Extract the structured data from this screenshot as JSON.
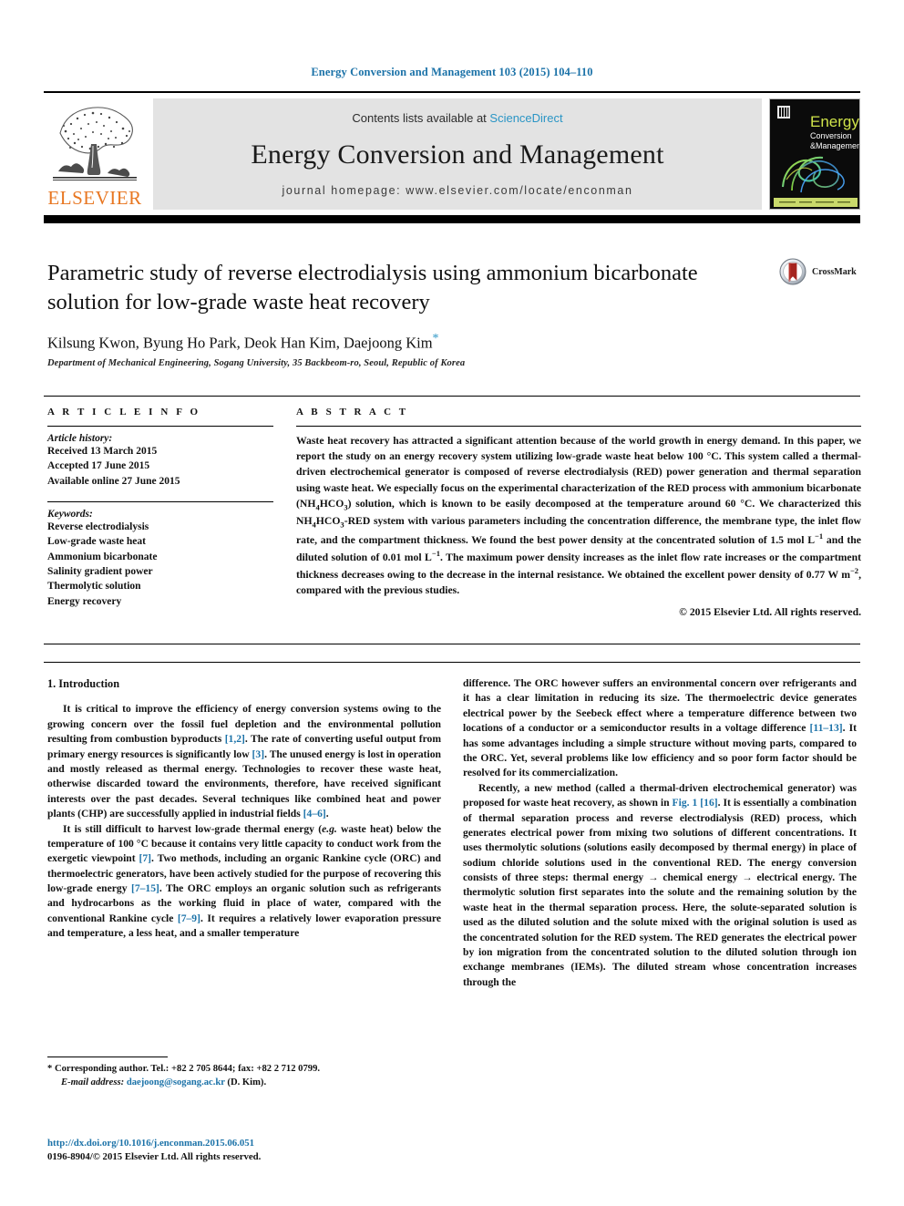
{
  "running_head": "Energy Conversion and Management 103 (2015) 104–110",
  "masthead": {
    "publisher": "ELSEVIER",
    "contents_prefix": "Contents lists available at ",
    "contents_link": "ScienceDirect",
    "journal_title": "Energy Conversion and Management",
    "homepage": "journal homepage: www.elsevier.com/locate/enconman",
    "cover": {
      "line1": "Energy",
      "line2": "Conversion",
      "line3": "&Management"
    }
  },
  "article": {
    "title": "Parametric study of reverse electrodialysis using ammonium bicarbonate solution for low-grade waste heat recovery",
    "authors": "Kilsung Kwon, Byung Ho Park, Deok Han Kim, Daejoong Kim",
    "corresponding_marker": "*",
    "affiliation": "Department of Mechanical Engineering, Sogang University, 35 Backbeom-ro, Seoul, Republic of Korea",
    "crossmark_label": "CrossMark"
  },
  "article_info": {
    "heading": "A R T I C L E   I N F O",
    "history_label": "Article history:",
    "history": [
      "Received 13 March 2015",
      "Accepted 17 June 2015",
      "Available online 27 June 2015"
    ],
    "keywords_label": "Keywords:",
    "keywords": [
      "Reverse electrodialysis",
      "Low-grade waste heat",
      "Ammonium bicarbonate",
      "Salinity gradient power",
      "Thermolytic solution",
      "Energy recovery"
    ]
  },
  "abstract": {
    "heading": "A B S T R A C T",
    "part1": "Waste heat recovery has attracted a significant attention because of the world growth in energy demand. In this paper, we report the study on an energy recovery system utilizing low-grade waste heat below 100 °C. This system called a thermal-driven electrochemical generator is composed of reverse electrodialysis (RED) power generation and thermal separation using waste heat. We especially focus on the experimental characterization of the RED process with ammonium bicarbonate (NH",
    "sub1": "4",
    "part2": "HCO",
    "sub2": "3",
    "part3": ") solution, which is known to be easily decomposed at the temperature around 60 °C. We characterized this NH",
    "sub3": "4",
    "part4": "HCO",
    "sub4": "3",
    "part5": "-RED system with various parameters including the concentration difference, the membrane type, the inlet flow rate, and the compartment thickness. We found the best power density at the concentrated solution of 1.5 mol L",
    "sup1": "−1",
    "part6": " and the diluted solution of 0.01 mol L",
    "sup2": "−1",
    "part7": ". The maximum power density increases as the inlet flow rate increases or the compartment thickness decreases owing to the decrease in the internal resistance. We obtained the excellent power density of 0.77 W m",
    "sup3": "−2",
    "part8": ", compared with the previous studies.",
    "copyright": "© 2015 Elsevier Ltd. All rights reserved."
  },
  "body": {
    "section_heading": "1. Introduction",
    "left": {
      "p1_a": "It is critical to improve the efficiency of energy conversion systems owing to the growing concern over the fossil fuel depletion and the environmental pollution resulting from combustion byproducts ",
      "p1_ref1": "[1,2]",
      "p1_b": ". The rate of converting useful output from primary energy resources is significantly low ",
      "p1_ref2": "[3]",
      "p1_c": ". The unused energy is lost in operation and mostly released as thermal energy. Technologies to recover these waste heat, otherwise discarded toward the environments, therefore, have received significant interests over the past decades. Several techniques like combined heat and power plants (CHP) are successfully applied in industrial fields ",
      "p1_ref3": "[4–6]",
      "p1_d": ".",
      "p2_a": "It is still difficult to harvest low-grade thermal energy (",
      "p2_it": "e.g.",
      "p2_b": " waste heat) below the temperature of 100 °C because it contains very little capacity to conduct work from the exergetic viewpoint ",
      "p2_ref1": "[7]",
      "p2_c": ". Two methods, including an organic Rankine cycle (ORC) and thermoelectric generators, have been actively studied for the purpose of recovering this low-grade energy ",
      "p2_ref2": "[7–15]",
      "p2_d": ". The ORC employs an organic solution such as refrigerants and hydrocarbons as the working fluid in place of water, compared with the conventional Rankine cycle ",
      "p2_ref3": "[7–9]",
      "p2_e": ". It requires a relatively lower evaporation pressure and temperature, a less heat, and a smaller temperature"
    },
    "right": {
      "p1_a": "difference. The ORC however suffers an environmental concern over refrigerants and it has a clear limitation in reducing its size. The thermoelectric device generates electrical power by the Seebeck effect where a temperature difference between two locations of a conductor or a semiconductor results in a voltage difference ",
      "p1_ref1": "[11–13]",
      "p1_b": ". It has some advantages including a simple structure without moving parts, compared to the ORC. Yet, several problems like low efficiency and so poor form factor should be resolved for its commercialization.",
      "p2_a": "Recently, a new method (called a thermal-driven electrochemical generator) was proposed for waste heat recovery, as shown in ",
      "p2_ref1": "Fig. 1",
      "p2_mid": " ",
      "p2_ref2": "[16]",
      "p2_b": ". It is essentially a combination of thermal separation process and reverse electrodialysis (RED) process, which generates electrical power from mixing two solutions of different concentrations. It uses thermolytic solutions (solutions easily decomposed by thermal energy) in place of sodium chloride solutions used in the conventional RED. The energy conversion consists of three steps: thermal energy → chemical energy → electrical energy. The thermolytic solution first separates into the solute and the remaining solution by the waste heat in the thermal separation process. Here, the solute-separated solution is used as the diluted solution and the solute mixed with the original solution is used as the concentrated solution for the RED system. The RED generates the electrical power by ion migration from the concentrated solution to the diluted solution through ion exchange membranes (IEMs). The diluted stream whose concentration increases through the"
    }
  },
  "footnote": {
    "marker": "*",
    "corresponding": " Corresponding author. Tel.: +82 2 705 8644; fax: +82 2 712 0799.",
    "email_label": "E-mail address:",
    "email": "daejoong@sogang.ac.kr",
    "email_suffix": " (D. Kim)."
  },
  "footer": {
    "doi": "http://dx.doi.org/10.1016/j.enconman.2015.06.051",
    "issn_line": "0196-8904/© 2015 Elsevier Ltd. All rights reserved."
  },
  "colors": {
    "link": "#1b72a8",
    "sciencedirect": "#2a95c5",
    "elsevier_orange": "#e87722",
    "panel_gray": "#e3e3e3"
  }
}
